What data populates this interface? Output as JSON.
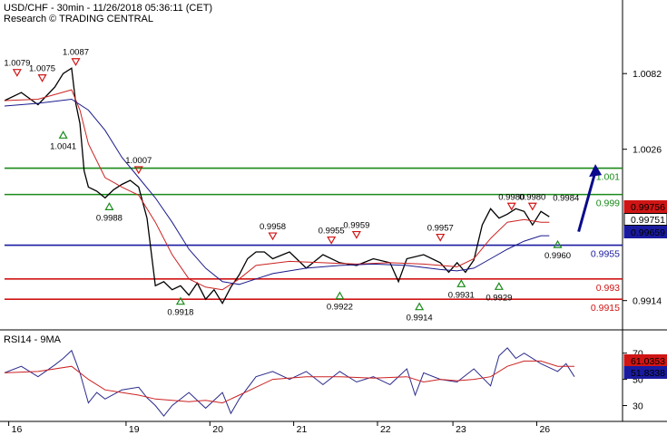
{
  "header": {
    "line1": "USD/CHF - 30min - 11/26/2018 05:36:11 (CET)",
    "line2": "Research © TRADING CENTRAL"
  },
  "rsi_panel": {
    "label": "RSI14 - 9MA"
  },
  "colors": {
    "price": "#000000",
    "ma_red": "#cc2222",
    "ma_blue": "#1a1a8c",
    "level_green": "#1a8a1a",
    "level_red": "#d01515",
    "level_blue": "#1a1aa0",
    "arrow": "#0a0a8c",
    "rsi": "#2a2a8c",
    "rsi_ma": "#cc2222"
  },
  "chart_data": [
    {
      "type": "line",
      "title": "USD/CHF - 30min - 11/26/2018 05:36:11 (CET)",
      "ylim": [
        0.9895,
        1.0115
      ],
      "yticks": [
        "1.0082",
        "1.0026",
        "0.9914"
      ],
      "ytick_values": [
        1.0082,
        1.0026,
        0.9914
      ],
      "xtick_labels": [
        "16",
        "19",
        "20",
        "21",
        "22",
        "23",
        "26"
      ],
      "xtick_positions": [
        0.5,
        14.5,
        24.5,
        34.5,
        44.5,
        53.5,
        63.5
      ],
      "x_range": [
        0,
        68
      ],
      "series": [
        {
          "name": "",
          "role": "price",
          "x": [
            0,
            2,
            4,
            6,
            7,
            8,
            8.5,
            9,
            9.5,
            10,
            11,
            12,
            13,
            14,
            15,
            16,
            17,
            18,
            19,
            20,
            21,
            22,
            23,
            24,
            25,
            26,
            27,
            28,
            29,
            30,
            31,
            32,
            34,
            36,
            38,
            40,
            42,
            44,
            46,
            47,
            48,
            50,
            52,
            53,
            54,
            55,
            56,
            57,
            58,
            59,
            60,
            61,
            62,
            63,
            64,
            65
          ],
          "y": [
            1.0062,
            1.0068,
            1.0059,
            1.0072,
            1.0082,
            1.0086,
            1.006,
            1.0045,
            1.001,
            0.9998,
            0.9995,
            0.999,
            0.9996,
            1.0,
            1.0003,
            0.9998,
            0.9975,
            0.9925,
            0.9928,
            0.9922,
            0.9925,
            0.9918,
            0.9927,
            0.9915,
            0.9922,
            0.9912,
            0.9924,
            0.9933,
            0.9945,
            0.995,
            0.995,
            0.9945,
            0.995,
            0.9938,
            0.9948,
            0.9942,
            0.994,
            0.9945,
            0.9942,
            0.9928,
            0.9945,
            0.9948,
            0.9942,
            0.9935,
            0.9942,
            0.9935,
            0.9944,
            0.997,
            0.9982,
            0.9975,
            0.9978,
            0.9982,
            0.998,
            0.997,
            0.998,
            0.9976
          ]
        },
        {
          "name": "",
          "role": "ma_fast",
          "x": [
            0,
            4,
            8,
            9,
            10,
            12,
            14,
            16,
            18,
            20,
            22,
            24,
            26,
            28,
            30,
            34,
            38,
            42,
            46,
            50,
            54,
            56,
            58,
            60,
            62,
            64,
            65
          ],
          "y": [
            1.0062,
            1.0063,
            1.007,
            1.0055,
            1.003,
            1.0005,
            0.9998,
            0.9992,
            0.9972,
            0.9948,
            0.993,
            0.9924,
            0.9922,
            0.993,
            0.994,
            0.9943,
            0.9942,
            0.9941,
            0.9942,
            0.9941,
            0.9939,
            0.9945,
            0.996,
            0.9972,
            0.9974,
            0.9972,
            0.9972
          ]
        },
        {
          "name": "",
          "role": "ma_slow",
          "x": [
            0,
            4,
            8,
            10,
            12,
            14,
            16,
            18,
            20,
            22,
            24,
            26,
            28,
            30,
            32,
            36,
            40,
            44,
            48,
            52,
            54,
            56,
            58,
            60,
            62,
            64,
            65
          ],
          "y": [
            1.0058,
            1.006,
            1.0063,
            1.0055,
            1.004,
            1.002,
            1.0005,
            0.999,
            0.9972,
            0.9952,
            0.9938,
            0.9928,
            0.9926,
            0.993,
            0.9934,
            0.9938,
            0.994,
            0.9941,
            0.994,
            0.9937,
            0.9936,
            0.9938,
            0.9945,
            0.9952,
            0.9958,
            0.9962,
            0.9962
          ]
        }
      ],
      "levels": [
        {
          "label": "1.001",
          "value": 1.0012,
          "color": "green"
        },
        {
          "label": "0.999",
          "value": 0.99925,
          "color": "green"
        },
        {
          "label": "0.9955",
          "value": 0.9955,
          "color": "blue"
        },
        {
          "label": "0.993",
          "value": 0.993,
          "color": "red"
        },
        {
          "label": "0.9915",
          "value": 0.9915,
          "color": "red"
        }
      ],
      "price_tags": [
        {
          "label": "0.99756",
          "value": 0.99756,
          "style": "red"
        },
        {
          "label": "0.99751",
          "value": 0.99751,
          "style": "black"
        },
        {
          "label": "0.99659",
          "value": 0.99659,
          "style": "blue"
        }
      ],
      "annotations": [
        {
          "text": "1.0079",
          "x": 1.5,
          "y": 1.0079,
          "marker": "down"
        },
        {
          "text": "1.0075",
          "x": 4.5,
          "y": 1.0075,
          "marker": "down"
        },
        {
          "text": "1.0087",
          "x": 8.5,
          "y": 1.0087,
          "marker": "down"
        },
        {
          "text": "1.0041",
          "x": 7.0,
          "y": 1.0041,
          "marker": "up"
        },
        {
          "text": "1.0007",
          "x": 16.0,
          "y": 1.0007,
          "marker": "down"
        },
        {
          "text": "0.9988",
          "x": 12.5,
          "y": 0.9988,
          "marker": "up"
        },
        {
          "text": "0.9918",
          "x": 21.0,
          "y": 0.9918,
          "marker": "up"
        },
        {
          "text": "0.9958",
          "x": 32.0,
          "y": 0.9958,
          "marker": "down"
        },
        {
          "text": "0.9955",
          "x": 39.0,
          "y": 0.9955,
          "marker": "down"
        },
        {
          "text": "0.9959",
          "x": 42.0,
          "y": 0.9959,
          "marker": "down"
        },
        {
          "text": "0.9922",
          "x": 40.0,
          "y": 0.9922,
          "marker": "up"
        },
        {
          "text": "0.9957",
          "x": 52.0,
          "y": 0.9957,
          "marker": "down"
        },
        {
          "text": "0.9914",
          "x": 49.5,
          "y": 0.9914,
          "marker": "up"
        },
        {
          "text": "0.9931",
          "x": 54.5,
          "y": 0.9931,
          "marker": "up"
        },
        {
          "text": "0.9929",
          "x": 59.0,
          "y": 0.9929,
          "marker": "up"
        },
        {
          "text": "0.9980",
          "x": 60.5,
          "y": 0.998,
          "marker": "down"
        },
        {
          "text": "0.9980",
          "x": 63.0,
          "y": 0.998,
          "marker": "down"
        },
        {
          "text": "0.9984",
          "x": 67.0,
          "y": 0.9984,
          "marker": "none"
        },
        {
          "text": "0.9960",
          "x": 66.0,
          "y": 0.996,
          "marker": "up"
        }
      ],
      "arrow": {
        "from": [
          68.5,
          0.9965
        ],
        "to": [
          70.5,
          1.0015
        ]
      },
      "grid": false
    },
    {
      "type": "line",
      "title": "RSI14 - 9MA",
      "ylim": [
        20,
        85
      ],
      "yticks": [
        "70",
        "50",
        "30"
      ],
      "ytick_values": [
        70,
        50,
        30
      ],
      "price_tags": [
        {
          "label": "61.0353",
          "value": 61.0353,
          "style": "red"
        },
        {
          "label": "51.8338",
          "value": 51.8338,
          "style": "blue"
        }
      ],
      "series": [
        {
          "name": "",
          "role": "rsi",
          "x": [
            0,
            2,
            4,
            6,
            7,
            8,
            9,
            10,
            11,
            12,
            14,
            16,
            17,
            18,
            19,
            20,
            22,
            24,
            26,
            27,
            28,
            30,
            32,
            34,
            36,
            38,
            40,
            42,
            44,
            46,
            48,
            49,
            50,
            52,
            54,
            56,
            58,
            59,
            60,
            61,
            62,
            64,
            66,
            67,
            68
          ],
          "y": [
            55,
            60,
            52,
            61,
            66,
            72,
            55,
            32,
            40,
            35,
            42,
            44,
            36,
            30,
            22,
            30,
            40,
            28,
            40,
            24,
            35,
            52,
            56,
            50,
            56,
            46,
            56,
            48,
            52,
            46,
            58,
            38,
            55,
            50,
            48,
            58,
            45,
            68,
            74,
            66,
            70,
            62,
            56,
            62,
            52
          ]
        },
        {
          "name": "",
          "role": "rsi_ma",
          "x": [
            0,
            4,
            8,
            10,
            12,
            14,
            16,
            18,
            20,
            22,
            24,
            26,
            28,
            30,
            32,
            36,
            40,
            44,
            48,
            50,
            52,
            54,
            56,
            58,
            60,
            62,
            64,
            66,
            68
          ],
          "y": [
            55,
            56,
            60,
            50,
            42,
            40,
            38,
            35,
            34,
            33,
            34,
            32,
            38,
            44,
            50,
            52,
            52,
            51,
            52,
            48,
            50,
            49,
            50,
            52,
            60,
            64,
            64,
            60,
            60
          ]
        }
      ]
    }
  ]
}
